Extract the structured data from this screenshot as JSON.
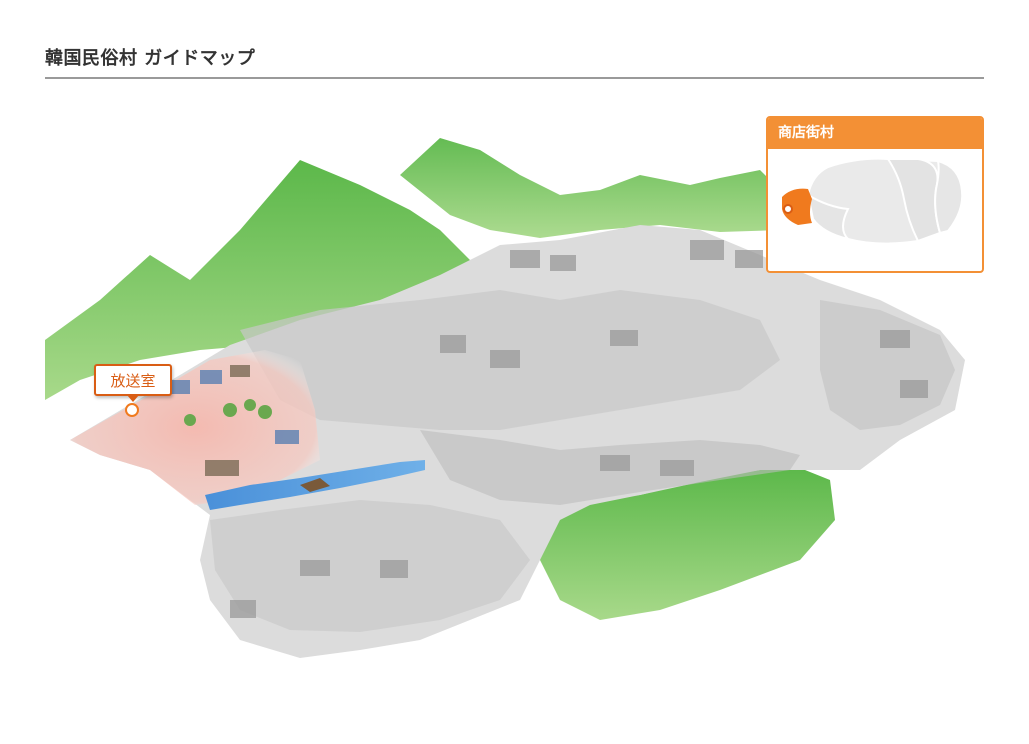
{
  "header": {
    "title": "韓国民俗村 ガイドマップ"
  },
  "map": {
    "marker": {
      "label": "放送室",
      "color": "#d95d14"
    },
    "highlight_color": "#f5b8ae"
  },
  "minimap": {
    "title": "商店街村",
    "accent_color": "#f39035",
    "selected_region_color": "#f07a1e"
  }
}
